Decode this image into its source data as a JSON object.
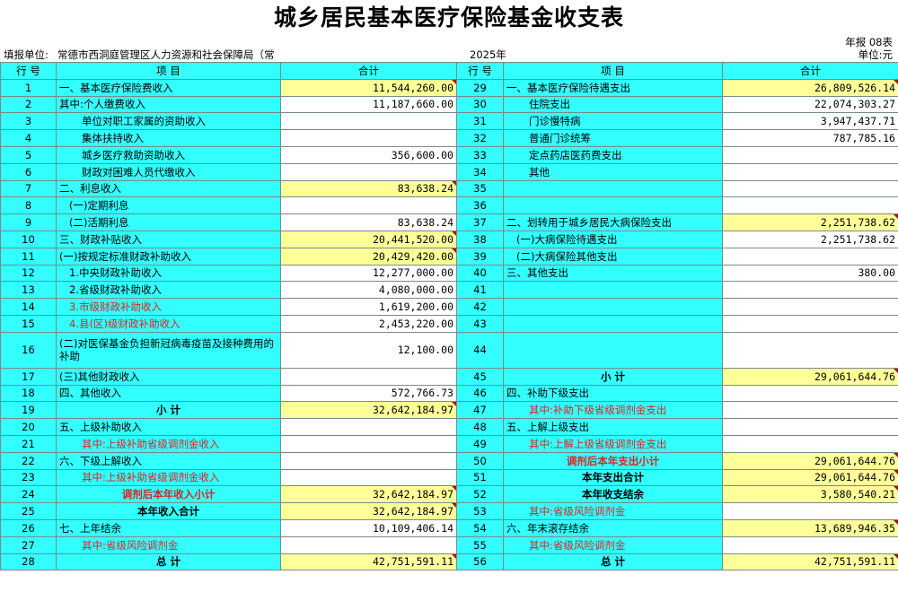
{
  "title": "城乡居民基本医疗保险基金收支表",
  "report_code": "年报 08表",
  "fill_unit_label": "填报单位:",
  "fill_unit": "常德市西洞庭管理区人力资源和社会保障局（常",
  "year": "2025年",
  "unit": "单位:元",
  "headers": {
    "row_no": "行 号",
    "item": "项    目",
    "total": "合计"
  },
  "left_rows": [
    {
      "no": "1",
      "item": "一、基本医疗保险费收入",
      "value": "11,544,260.00"
    },
    {
      "no": "2",
      "item": "其中:个人缴费收入",
      "value": "11,187,660.00"
    },
    {
      "no": "3",
      "item": "单位对职工家属的资助收入",
      "value": ""
    },
    {
      "no": "4",
      "item": "集体扶持收入",
      "value": ""
    },
    {
      "no": "5",
      "item": "城乡医疗救助资助收入",
      "value": "356,600.00"
    },
    {
      "no": "6",
      "item": "财政对困难人员代缴收入",
      "value": ""
    },
    {
      "no": "7",
      "item": "二、利息收入",
      "value": "83,638.24"
    },
    {
      "no": "8",
      "item": "(一)定期利息",
      "value": ""
    },
    {
      "no": "9",
      "item": "(二)活期利息",
      "value": "83,638.24"
    },
    {
      "no": "10",
      "item": "三、财政补贴收入",
      "value": "20,441,520.00"
    },
    {
      "no": "11",
      "item": "(一)按规定标准财政补助收入",
      "value": "20,429,420.00"
    },
    {
      "no": "12",
      "item": "1.中央财政补助收入",
      "value": "12,277,000.00"
    },
    {
      "no": "13",
      "item": "2.省级财政补助收入",
      "value": "4,080,000.00"
    },
    {
      "no": "14",
      "item": "3.市级财政补助收入",
      "value": "1,619,200.00"
    },
    {
      "no": "15",
      "item": "4.县(区)级财政补助收入",
      "value": "2,453,220.00"
    },
    {
      "no": "16",
      "item": "(二)对医保基金负担新冠病毒疫苗及接种费用的补助",
      "value": "12,100.00"
    },
    {
      "no": "17",
      "item": "(三)其他财政收入",
      "value": ""
    },
    {
      "no": "18",
      "item": "四、其他收入",
      "value": "572,766.73"
    },
    {
      "no": "19",
      "item": "小    计",
      "value": "32,642,184.97"
    },
    {
      "no": "20",
      "item": "五、上级补助收入",
      "value": ""
    },
    {
      "no": "21",
      "item": "其中:上级补助省级调剂金收入",
      "value": ""
    },
    {
      "no": "22",
      "item": "六、下级上解收入",
      "value": ""
    },
    {
      "no": "23",
      "item": "其中:上级补助省级调剂金收入",
      "value": ""
    },
    {
      "no": "24",
      "item": "调剂后本年收入小计",
      "value": "32,642,184.97"
    },
    {
      "no": "25",
      "item": "本年收入合计",
      "value": "32,642,184.97"
    },
    {
      "no": "26",
      "item": "七、上年结余",
      "value": "10,109,406.14"
    },
    {
      "no": "27",
      "item": "其中:省级风险调剂金",
      "value": ""
    },
    {
      "no": "28",
      "item": "总    计",
      "value": "42,751,591.11"
    }
  ],
  "right_rows": [
    {
      "no": "29",
      "item": "一、基本医疗保险待遇支出",
      "value": "26,809,526.14"
    },
    {
      "no": "30",
      "item": "住院支出",
      "value": "22,074,303.27"
    },
    {
      "no": "31",
      "item": "门诊慢特病",
      "value": "3,947,437.71"
    },
    {
      "no": "32",
      "item": "普通门诊统筹",
      "value": "787,785.16"
    },
    {
      "no": "33",
      "item": "定点药店医药费支出",
      "value": ""
    },
    {
      "no": "34",
      "item": "其他",
      "value": ""
    },
    {
      "no": "35",
      "item": "",
      "value": ""
    },
    {
      "no": "36",
      "item": "",
      "value": ""
    },
    {
      "no": "37",
      "item": "二、划转用于城乡居民大病保险支出",
      "value": "2,251,738.62"
    },
    {
      "no": "38",
      "item": "(一)大病保险待遇支出",
      "value": "2,251,738.62"
    },
    {
      "no": "39",
      "item": "(二)大病保险其他支出",
      "value": ""
    },
    {
      "no": "40",
      "item": "三、其他支出",
      "value": "380.00"
    },
    {
      "no": "41",
      "item": "",
      "value": ""
    },
    {
      "no": "42",
      "item": "",
      "value": ""
    },
    {
      "no": "43",
      "item": "",
      "value": ""
    },
    {
      "no": "44",
      "item": "",
      "value": ""
    },
    {
      "no": "45",
      "item": "小    计",
      "value": "29,061,644.76"
    },
    {
      "no": "46",
      "item": "四、补助下级支出",
      "value": ""
    },
    {
      "no": "47",
      "item": "其中:补助下级省级调剂金支出",
      "value": ""
    },
    {
      "no": "48",
      "item": "五、上解上级支出",
      "value": ""
    },
    {
      "no": "49",
      "item": "其中:上解上级省级调剂金支出",
      "value": ""
    },
    {
      "no": "50",
      "item": "调剂后本年支出小计",
      "value": "29,061,644.76"
    },
    {
      "no": "51",
      "item": "本年支出合计",
      "value": "29,061,644.76"
    },
    {
      "no": "52",
      "item": "本年收支结余",
      "value": "3,580,540.21"
    },
    {
      "no": "53",
      "item": "其中:省级风险调剂金",
      "value": ""
    },
    {
      "no": "54",
      "item": "六、年末滚存结余",
      "value": "13,689,946.35"
    },
    {
      "no": "55",
      "item": "其中:省级风险调剂金",
      "value": ""
    },
    {
      "no": "56",
      "item": "总    计",
      "value": "42,751,591.11"
    }
  ],
  "colors": {
    "cyan": "#33ffff",
    "yellow": "#ffff99",
    "red_text": "#e02020"
  }
}
